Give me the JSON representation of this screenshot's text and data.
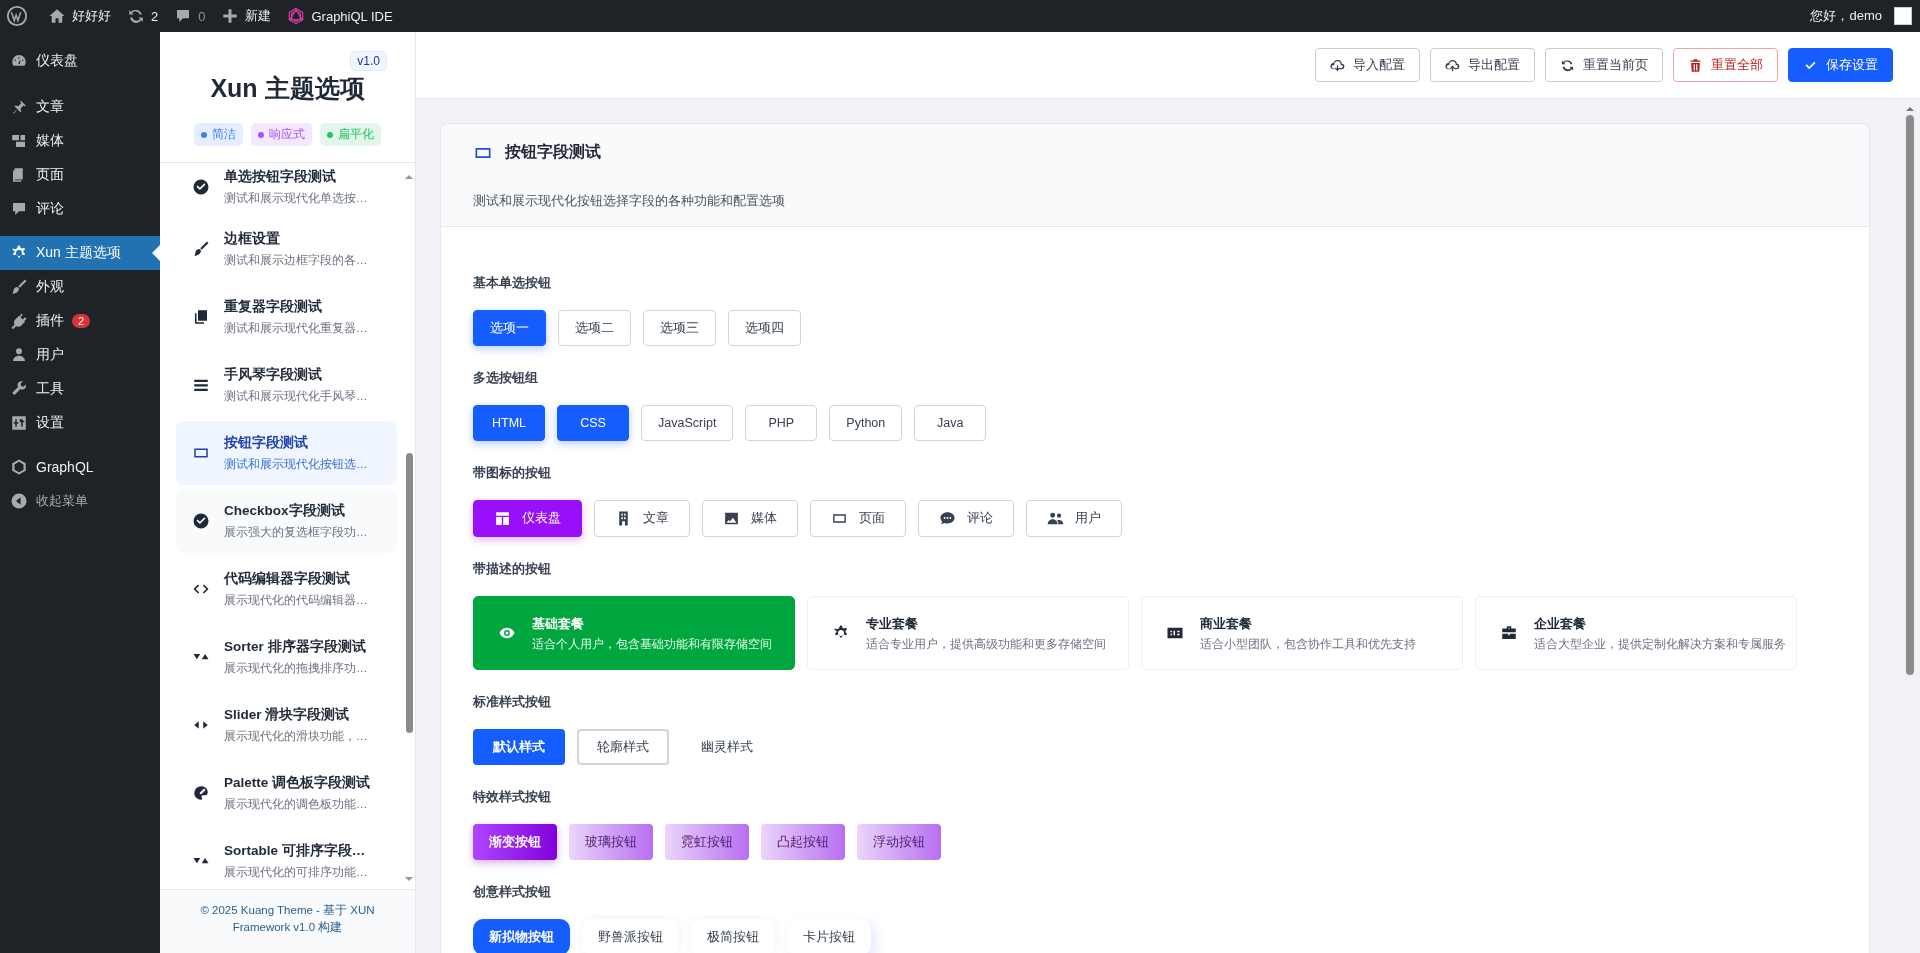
{
  "admin_bar": {
    "site": "好好好",
    "updates": "2",
    "comments": "0",
    "new": "新建",
    "graphiql": "GraphiQL IDE",
    "greeting": "您好，demo"
  },
  "admin_menu": [
    {
      "label": "仪表盘",
      "selected": false
    },
    {
      "label": "文章",
      "selected": false
    },
    {
      "label": "媒体",
      "selected": false
    },
    {
      "label": "页面",
      "selected": false
    },
    {
      "label": "评论",
      "selected": false
    },
    {
      "label": "Xun 主题选项",
      "selected": true
    },
    {
      "label": "外观",
      "selected": false
    },
    {
      "label": "插件",
      "selected": false,
      "badge": "2"
    },
    {
      "label": "用户",
      "selected": false
    },
    {
      "label": "工具",
      "selected": false
    },
    {
      "label": "设置",
      "selected": false
    },
    {
      "label": "GraphQL",
      "selected": false
    },
    {
      "label": "收起菜单",
      "selected": false
    }
  ],
  "theme_panel": {
    "version": "v1.0",
    "title": "Xun 主题选项",
    "tags": [
      {
        "label": "简洁",
        "color": "#3b82f6"
      },
      {
        "label": "响应式",
        "color": "#a855f7"
      },
      {
        "label": "扁平化",
        "color": "#22c55e"
      }
    ],
    "sections": [
      {
        "title": "单选按钮字段测试",
        "desc": "测试和展示现代化单选按…",
        "selected": false
      },
      {
        "title": "边框设置",
        "desc": "测试和展示边框字段的各…",
        "selected": false
      },
      {
        "title": "重复器字段测试",
        "desc": "测试和展示现代化重复器…",
        "selected": false
      },
      {
        "title": "手风琴字段测试",
        "desc": "测试和展示现代化手风琴…",
        "selected": false
      },
      {
        "title": "按钮字段测试",
        "desc": "测试和展示现代化按钮选…",
        "selected": true
      },
      {
        "title": "Checkbox字段测试",
        "desc": "展示强大的复选框字段功…",
        "selected": false
      },
      {
        "title": "代码编辑器字段测试",
        "desc": "展示现代化的代码编辑器…",
        "selected": false
      },
      {
        "title": "Sorter 排序器字段测试",
        "desc": "展示现代化的拖拽排序功…",
        "selected": false
      },
      {
        "title": "Slider 滑块字段测试",
        "desc": "展示现代化的滑块功能，…",
        "selected": false
      },
      {
        "title": "Palette 调色板字段测试",
        "desc": "展示现代化的调色板功能…",
        "selected": false
      },
      {
        "title": "Sortable 可排序字段…",
        "desc": "展示现代化的可排序功能…",
        "selected": false
      }
    ],
    "footer": "© 2025 Kuang Theme - 基于 XUN Framework v1.0 构建"
  },
  "toolbar": [
    {
      "label": "导入配置",
      "kind": "default"
    },
    {
      "label": "导出配置",
      "kind": "default"
    },
    {
      "label": "重置当前页",
      "kind": "default"
    },
    {
      "label": "重置全部",
      "kind": "danger"
    },
    {
      "label": "保存设置",
      "kind": "primary"
    }
  ],
  "card": {
    "title": "按钮字段测试",
    "desc": "测试和展示现代化按钮选择字段的各种功能和配置选项",
    "radio": {
      "label": "基本单选按钮",
      "options": [
        {
          "label": "选项一",
          "selected": true
        },
        {
          "label": "选项二",
          "selected": false
        },
        {
          "label": "选项三",
          "selected": false
        },
        {
          "label": "选项四",
          "selected": false
        }
      ]
    },
    "multi": {
      "label": "多选按钮组",
      "options": [
        {
          "label": "HTML",
          "selected": true
        },
        {
          "label": "CSS",
          "selected": true
        },
        {
          "label": "JavaScript",
          "selected": false
        },
        {
          "label": "PHP",
          "selected": false
        },
        {
          "label": "Python",
          "selected": false
        },
        {
          "label": "Java",
          "selected": false
        }
      ]
    },
    "icon_buttons": {
      "label": "带图标的按钮",
      "options": [
        {
          "label": "仪表盘",
          "selected": true
        },
        {
          "label": "文章",
          "selected": false
        },
        {
          "label": "媒体",
          "selected": false
        },
        {
          "label": "页面",
          "selected": false
        },
        {
          "label": "评论",
          "selected": false
        },
        {
          "label": "用户",
          "selected": false
        }
      ]
    },
    "desc_buttons": {
      "label": "带描述的按钮",
      "options": [
        {
          "title": "基础套餐",
          "desc": "适合个人用户，包含基础功能和有限存储空间",
          "selected": true
        },
        {
          "title": "专业套餐",
          "desc": "适合专业用户，提供高级功能和更多存储空间",
          "selected": false
        },
        {
          "title": "商业套餐",
          "desc": "适合小型团队，包含协作工具和优先支持",
          "selected": false
        },
        {
          "title": "企业套餐",
          "desc": "适合大型企业，提供定制化解决方案和专属服务",
          "selected": false
        }
      ]
    },
    "standard": {
      "label": "标准样式按钮",
      "options": [
        {
          "label": "默认样式",
          "kind": "filled"
        },
        {
          "label": "轮廓样式",
          "kind": "outline"
        },
        {
          "label": "幽灵样式",
          "kind": "ghost"
        }
      ]
    },
    "effects": {
      "label": "特效样式按钮",
      "options": [
        {
          "label": "渐变按钮",
          "kind": "gradient"
        },
        {
          "label": "玻璃按钮",
          "kind": "soft"
        },
        {
          "label": "霓虹按钮",
          "kind": "soft"
        },
        {
          "label": "凸起按钮",
          "kind": "soft"
        },
        {
          "label": "浮动按钮",
          "kind": "soft"
        }
      ]
    },
    "creative": {
      "label": "创意样式按钮",
      "options": [
        {
          "label": "新拟物按钮",
          "kind": "filled"
        },
        {
          "label": "野兽派按钮",
          "kind": "plain"
        },
        {
          "label": "极简按钮",
          "kind": "plain"
        },
        {
          "label": "卡片按钮",
          "kind": "card"
        }
      ]
    }
  }
}
